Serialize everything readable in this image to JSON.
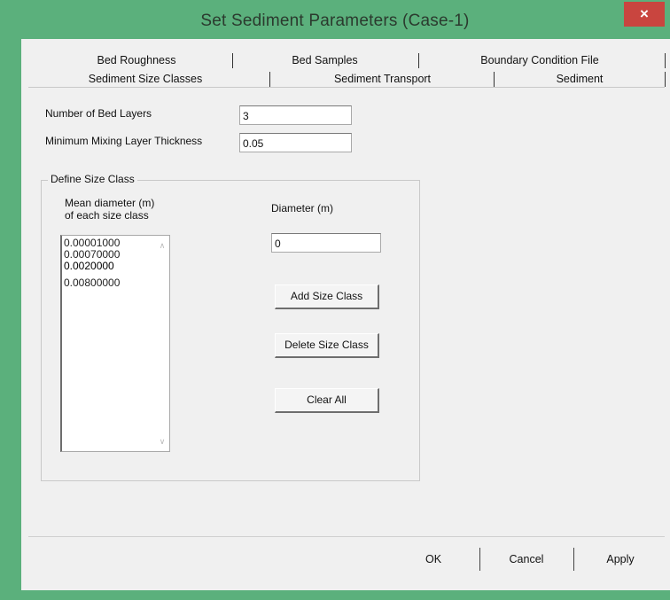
{
  "window": {
    "title": "Set Sediment Parameters (Case-1)",
    "close_label": "×",
    "accent_color": "#5bb07c"
  },
  "tabs": {
    "row1": [
      "Bed Roughness",
      "Bed Samples",
      "Boundary Condition File"
    ],
    "row2": [
      "Sediment Size Classes",
      "Sediment Transport",
      "Sediment"
    ],
    "active": "Sediment Size Classes"
  },
  "fields": {
    "bed_layers_label": "Number of Bed Layers",
    "bed_layers_value": "3",
    "mixing_label": "Minimum Mixing Layer Thickness",
    "mixing_value": "0.05"
  },
  "size_class": {
    "group_title": "Define Size Class",
    "list_label_line1": "Mean diameter (m)",
    "list_label_line2": "of each size class",
    "items": [
      "0.00001000",
      "0.00070000",
      "0.0020000",
      "0.00800000"
    ],
    "diameter_label": "Diameter (m)",
    "diameter_value": "0",
    "add_button": "Add Size Class",
    "delete_button": "Delete Size Class",
    "clear_button": "Clear All"
  },
  "footer": {
    "ok": "OK",
    "cancel": "Cancel",
    "apply": "Apply"
  }
}
